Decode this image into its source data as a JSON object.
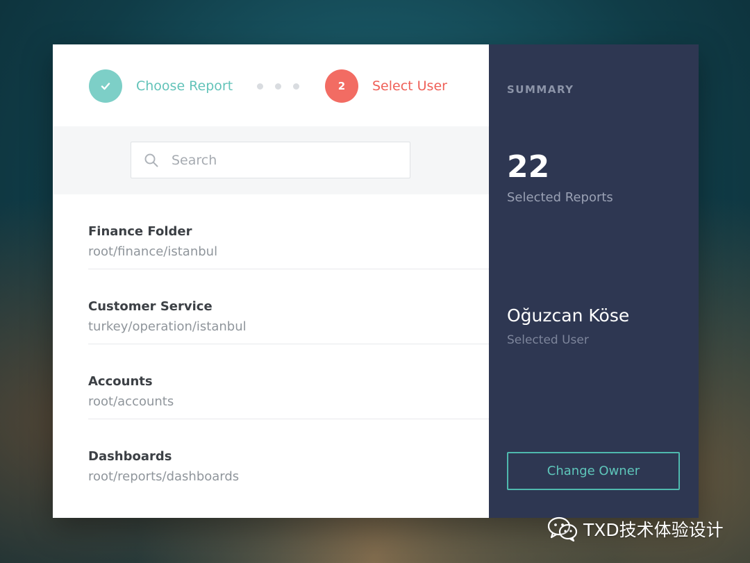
{
  "stepper": {
    "steps": [
      {
        "label": "Choose Report",
        "status": "completed"
      },
      {
        "number": "2",
        "label": "Select User",
        "status": "active"
      }
    ]
  },
  "search": {
    "placeholder": "Search",
    "value": ""
  },
  "list": {
    "items": [
      {
        "title": "Finance Folder",
        "path": "root/finance/istanbul"
      },
      {
        "title": "Customer Service",
        "path": "turkey/operation/istanbul"
      },
      {
        "title": "Accounts",
        "path": "root/accounts"
      },
      {
        "title": "Dashboards",
        "path": "root/reports/dashboards"
      }
    ]
  },
  "summary": {
    "title": "SUMMARY",
    "selected_reports_count": "22",
    "selected_reports_label": "Selected Reports",
    "selected_user_name": "Oğuzcan Köse",
    "selected_user_label": "Selected User",
    "change_owner_label": "Change Owner"
  },
  "watermark": {
    "text": "TXD技术体验设计"
  },
  "colors": {
    "completed_step": "#7dcfc7",
    "active_step": "#f26c63",
    "summary_panel": "#2e3752",
    "accent_teal": "#4fb9ae"
  },
  "icons": {
    "step_completed": "checkmark-icon",
    "search": "search-icon",
    "watermark_logo": "wechat-icon"
  }
}
